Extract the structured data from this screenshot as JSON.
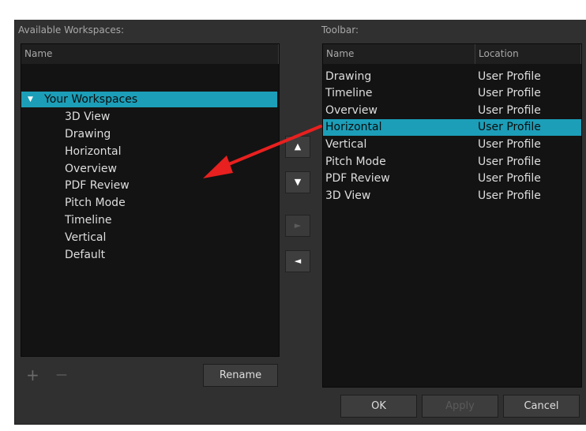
{
  "left": {
    "section_label": "Available Workspaces:",
    "column_name": "Name",
    "root_label": "Your Workspaces",
    "items": [
      "3D View",
      "Drawing",
      "Horizontal",
      "Overview",
      "PDF Review",
      "Pitch Mode",
      "Timeline",
      "Vertical",
      "Default"
    ]
  },
  "right": {
    "section_label": "Toolbar:",
    "columns": [
      "Name",
      "Location"
    ],
    "rows": [
      {
        "name": "Drawing",
        "location": "User Profile"
      },
      {
        "name": "Timeline",
        "location": "User Profile"
      },
      {
        "name": "Overview",
        "location": "User Profile"
      },
      {
        "name": "Horizontal",
        "location": "User Profile"
      },
      {
        "name": "Vertical",
        "location": "User Profile"
      },
      {
        "name": "Pitch Mode",
        "location": "User Profile"
      },
      {
        "name": "PDF Review",
        "location": "User Profile"
      },
      {
        "name": "3D View",
        "location": "User Profile"
      }
    ],
    "selected_row": "Horizontal"
  },
  "middle": {
    "up_icon": "▲",
    "down_icon": "▼",
    "add_icon": "►",
    "remove_icon": "◄"
  },
  "buttons": {
    "add_glyph": "+",
    "remove_glyph": "—",
    "rename": "Rename",
    "ok": "OK",
    "apply": "Apply",
    "cancel": "Cancel"
  },
  "colors": {
    "dialog_bg": "#303030",
    "panel_bg": "#131313",
    "selection": "#1c9eb8",
    "annotation_arrow": "#e8201f"
  }
}
